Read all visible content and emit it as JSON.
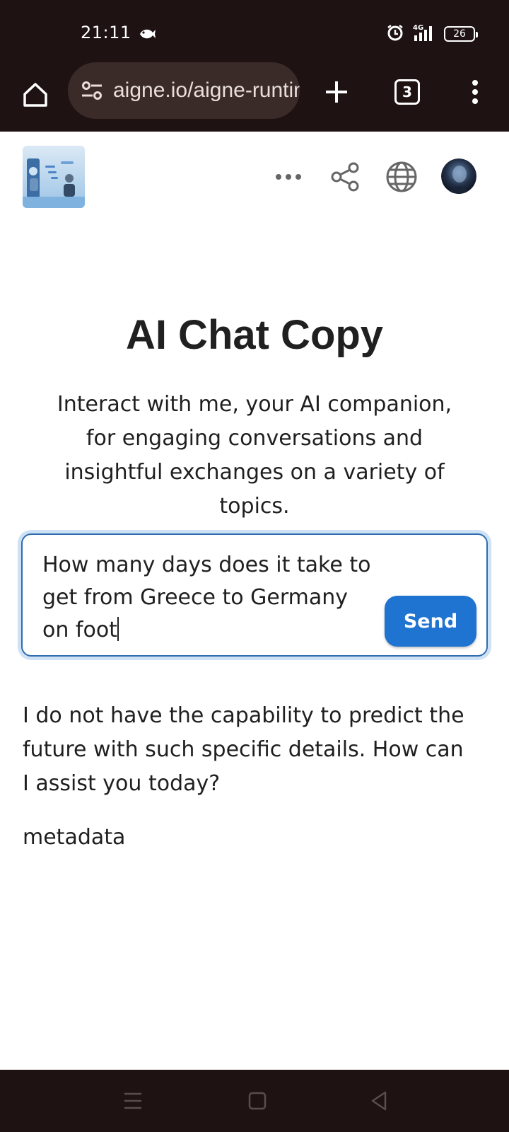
{
  "status_bar": {
    "time": "21:11",
    "network": "4G",
    "battery": "26"
  },
  "browser": {
    "url": "aigne.io/aigne-runtime/chat",
    "tab_count": "3"
  },
  "page": {
    "title": "AI Chat Copy",
    "subtitle": "Interact with me, your AI companion, for engaging conversations and insightful exchanges on a variety of topics.",
    "input_value": "How many days does it take to get from Greece to Germany on foot",
    "send_label": "Send",
    "answer": "I do not have the capability to predict the future with such specific details. How can I assist you today?",
    "metadata_label": "metadata"
  },
  "icons": {
    "home": "home-icon",
    "site_settings": "tune-icon",
    "new_tab": "plus-icon",
    "menu": "more-vert-icon",
    "more": "more-horiz-icon",
    "share": "share-icon",
    "language": "globe-icon",
    "nav_recents": "menu-lines-icon",
    "nav_home": "square-icon",
    "nav_back": "triangle-back-icon"
  },
  "colors": {
    "chrome_bg": "#1e1212",
    "url_pill": "#3a2b29",
    "accent": "#1f73d1",
    "input_border": "#2f6db0"
  }
}
